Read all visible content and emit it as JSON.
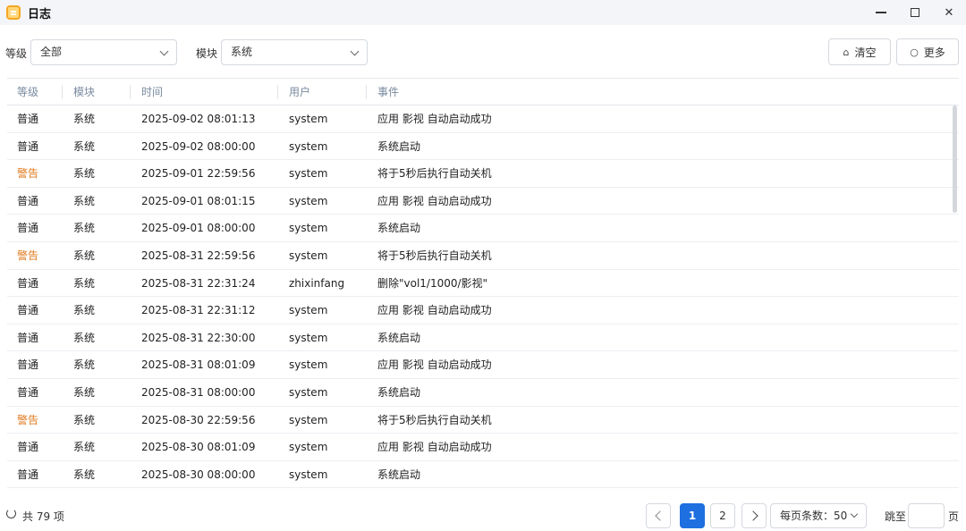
{
  "window": {
    "title": "日志",
    "icon": "notebook-icon",
    "controls": [
      "minimize-icon",
      "maximize-icon",
      "close-icon"
    ],
    "close_glyph": "✕"
  },
  "filters": {
    "level_label": "等级",
    "level_value": "全部",
    "module_label": "模块",
    "module_value": "系统",
    "clear_label": "清空",
    "clear_icon": "home-icon",
    "more_label": "更多",
    "more_icon": "circle-icon"
  },
  "columns": [
    "等级",
    "模块",
    "时间",
    "用户",
    "事件"
  ],
  "rows": [
    {
      "level": "普通",
      "module": "系统",
      "time": "2025-09-02 08:01:13",
      "user": "system",
      "event": "应用 影视 自动启动成功"
    },
    {
      "level": "普通",
      "module": "系统",
      "time": "2025-09-02 08:00:00",
      "user": "system",
      "event": "系统启动"
    },
    {
      "level": "警告",
      "module": "系统",
      "time": "2025-09-01 22:59:56",
      "user": "system",
      "event": "将于5秒后执行自动关机"
    },
    {
      "level": "普通",
      "module": "系统",
      "time": "2025-09-01 08:01:15",
      "user": "system",
      "event": "应用 影视 自动启动成功"
    },
    {
      "level": "普通",
      "module": "系统",
      "time": "2025-09-01 08:00:00",
      "user": "system",
      "event": "系统启动"
    },
    {
      "level": "警告",
      "module": "系统",
      "time": "2025-08-31 22:59:56",
      "user": "system",
      "event": "将于5秒后执行自动关机"
    },
    {
      "level": "普通",
      "module": "系统",
      "time": "2025-08-31 22:31:24",
      "user": "zhixinfang",
      "event": "删除\"vol1/1000/影视\""
    },
    {
      "level": "普通",
      "module": "系统",
      "time": "2025-08-31 22:31:12",
      "user": "system",
      "event": "应用 影视 自动启动成功"
    },
    {
      "level": "普通",
      "module": "系统",
      "time": "2025-08-31 22:30:00",
      "user": "system",
      "event": "系统启动"
    },
    {
      "level": "普通",
      "module": "系统",
      "time": "2025-08-31 08:01:09",
      "user": "system",
      "event": "应用 影视 自动启动成功"
    },
    {
      "level": "普通",
      "module": "系统",
      "time": "2025-08-31 08:00:00",
      "user": "system",
      "event": "系统启动"
    },
    {
      "level": "警告",
      "module": "系统",
      "time": "2025-08-30 22:59:56",
      "user": "system",
      "event": "将于5秒后执行自动关机"
    },
    {
      "level": "普通",
      "module": "系统",
      "time": "2025-08-30 08:01:09",
      "user": "system",
      "event": "应用 影视 自动启动成功"
    },
    {
      "level": "普通",
      "module": "系统",
      "time": "2025-08-30 08:00:00",
      "user": "system",
      "event": "系统启动"
    }
  ],
  "colors": {
    "warning": "#e07b1f",
    "accent": "#1e6fe0",
    "header_text": "#7a8aa0"
  },
  "footer": {
    "total": "共 79 项",
    "pages": [
      "1",
      "2"
    ],
    "current_page": "1",
    "page_size": "每页条数：50",
    "goto_label": "跳至",
    "goto_value": "",
    "goto_suffix": "页"
  }
}
